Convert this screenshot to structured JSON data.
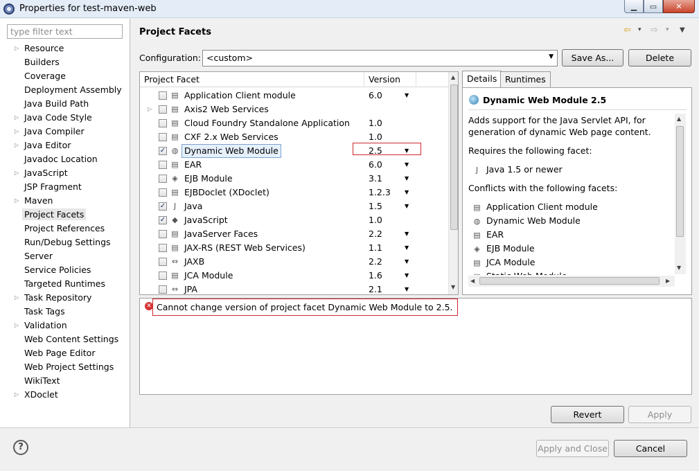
{
  "window": {
    "title": "Properties for test-maven-web",
    "minimize": "▁",
    "maximize": "▭",
    "close": "✕"
  },
  "filter": {
    "placeholder": "type filter text",
    "value": ""
  },
  "nav": {
    "items": [
      {
        "label": "Resource",
        "expandable": true
      },
      {
        "label": "Builders",
        "expandable": false
      },
      {
        "label": "Coverage",
        "expandable": false
      },
      {
        "label": "Deployment Assembly",
        "expandable": false
      },
      {
        "label": "Java Build Path",
        "expandable": false
      },
      {
        "label": "Java Code Style",
        "expandable": true
      },
      {
        "label": "Java Compiler",
        "expandable": true
      },
      {
        "label": "Java Editor",
        "expandable": true
      },
      {
        "label": "Javadoc Location",
        "expandable": false
      },
      {
        "label": "JavaScript",
        "expandable": true
      },
      {
        "label": "JSP Fragment",
        "expandable": false
      },
      {
        "label": "Maven",
        "expandable": true
      },
      {
        "label": "Project Facets",
        "expandable": false,
        "selected": true
      },
      {
        "label": "Project References",
        "expandable": false
      },
      {
        "label": "Run/Debug Settings",
        "expandable": false
      },
      {
        "label": "Server",
        "expandable": false
      },
      {
        "label": "Service Policies",
        "expandable": false
      },
      {
        "label": "Targeted Runtimes",
        "expandable": false
      },
      {
        "label": "Task Repository",
        "expandable": true
      },
      {
        "label": "Task Tags",
        "expandable": false
      },
      {
        "label": "Validation",
        "expandable": true
      },
      {
        "label": "Web Content Settings",
        "expandable": false
      },
      {
        "label": "Web Page Editor",
        "expandable": false
      },
      {
        "label": "Web Project Settings",
        "expandable": false
      },
      {
        "label": "WikiText",
        "expandable": false
      },
      {
        "label": "XDoclet",
        "expandable": true
      }
    ]
  },
  "header": {
    "title": "Project Facets",
    "back": "⇦",
    "forward": "⇨",
    "menu": "▼",
    "dropdown": "▾"
  },
  "configuration": {
    "label": "Configuration:",
    "value": "<custom>",
    "save_as": "Save As...",
    "delete": "Delete"
  },
  "facets": {
    "col_facet": "Project Facet",
    "col_version": "Version",
    "rows": [
      {
        "name": "Application Client module",
        "version": "6.0",
        "dropdown": true,
        "checked": false,
        "icon": "document-icon",
        "glyph": "▤"
      },
      {
        "name": "Axis2 Web Services",
        "version": "",
        "dropdown": false,
        "checked": false,
        "icon": "document-icon",
        "glyph": "▤",
        "expandable": true
      },
      {
        "name": "Cloud Foundry Standalone Application",
        "version": "1.0",
        "dropdown": false,
        "checked": false,
        "icon": "document-icon",
        "glyph": "▤"
      },
      {
        "name": "CXF 2.x Web Services",
        "version": "1.0",
        "dropdown": false,
        "checked": false,
        "icon": "document-icon",
        "glyph": "▤"
      },
      {
        "name": "Dynamic Web Module",
        "version": "2.5",
        "dropdown": true,
        "checked": true,
        "icon": "globe-icon",
        "glyph": "◍",
        "selected": true
      },
      {
        "name": "EAR",
        "version": "6.0",
        "dropdown": true,
        "checked": false,
        "icon": "document-icon",
        "glyph": "▤"
      },
      {
        "name": "EJB Module",
        "version": "3.1",
        "dropdown": true,
        "checked": false,
        "icon": "bean-icon",
        "glyph": "◈"
      },
      {
        "name": "EJBDoclet (XDoclet)",
        "version": "1.2.3",
        "dropdown": true,
        "checked": false,
        "icon": "document-icon",
        "glyph": "▤"
      },
      {
        "name": "Java",
        "version": "1.5",
        "dropdown": true,
        "checked": true,
        "icon": "java-icon",
        "glyph": "J"
      },
      {
        "name": "JavaScript",
        "version": "1.0",
        "dropdown": false,
        "checked": true,
        "icon": "javascript-icon",
        "glyph": "◆"
      },
      {
        "name": "JavaServer Faces",
        "version": "2.2",
        "dropdown": true,
        "checked": false,
        "icon": "document-icon",
        "glyph": "▤"
      },
      {
        "name": "JAX-RS (REST Web Services)",
        "version": "1.1",
        "dropdown": true,
        "checked": false,
        "icon": "document-icon",
        "glyph": "▤"
      },
      {
        "name": "JAXB",
        "version": "2.2",
        "dropdown": true,
        "checked": false,
        "icon": "jaxb-icon",
        "glyph": "⇔"
      },
      {
        "name": "JCA Module",
        "version": "1.6",
        "dropdown": true,
        "checked": false,
        "icon": "document-icon",
        "glyph": "▤"
      },
      {
        "name": "JPA",
        "version": "2.1",
        "dropdown": true,
        "checked": false,
        "icon": "jpa-icon",
        "glyph": "⇔"
      }
    ]
  },
  "details": {
    "tab_details": "Details",
    "tab_runtimes": "Runtimes",
    "title": "Dynamic Web Module 2.5",
    "desc_line1": "Adds support for the Java Servlet API, for",
    "desc_line2": "generation of dynamic Web page content.",
    "requires_label": "Requires the following facet:",
    "requires_item": "Java 1.5 or newer",
    "conflicts_label": "Conflicts with the following facets:",
    "conflicts": [
      "Application Client module",
      "Dynamic Web Module",
      "EAR",
      "EJB Module",
      "JCA Module",
      "Static Web Module"
    ]
  },
  "message": {
    "error": "Cannot change version of project facet Dynamic Web Module to 2.5."
  },
  "buttons": {
    "revert": "Revert",
    "apply": "Apply",
    "apply_close": "Apply and Close",
    "cancel": "Cancel",
    "help": "?"
  },
  "scroll": {
    "up": "▲",
    "down": "▼",
    "left": "◀",
    "right": "▶"
  }
}
